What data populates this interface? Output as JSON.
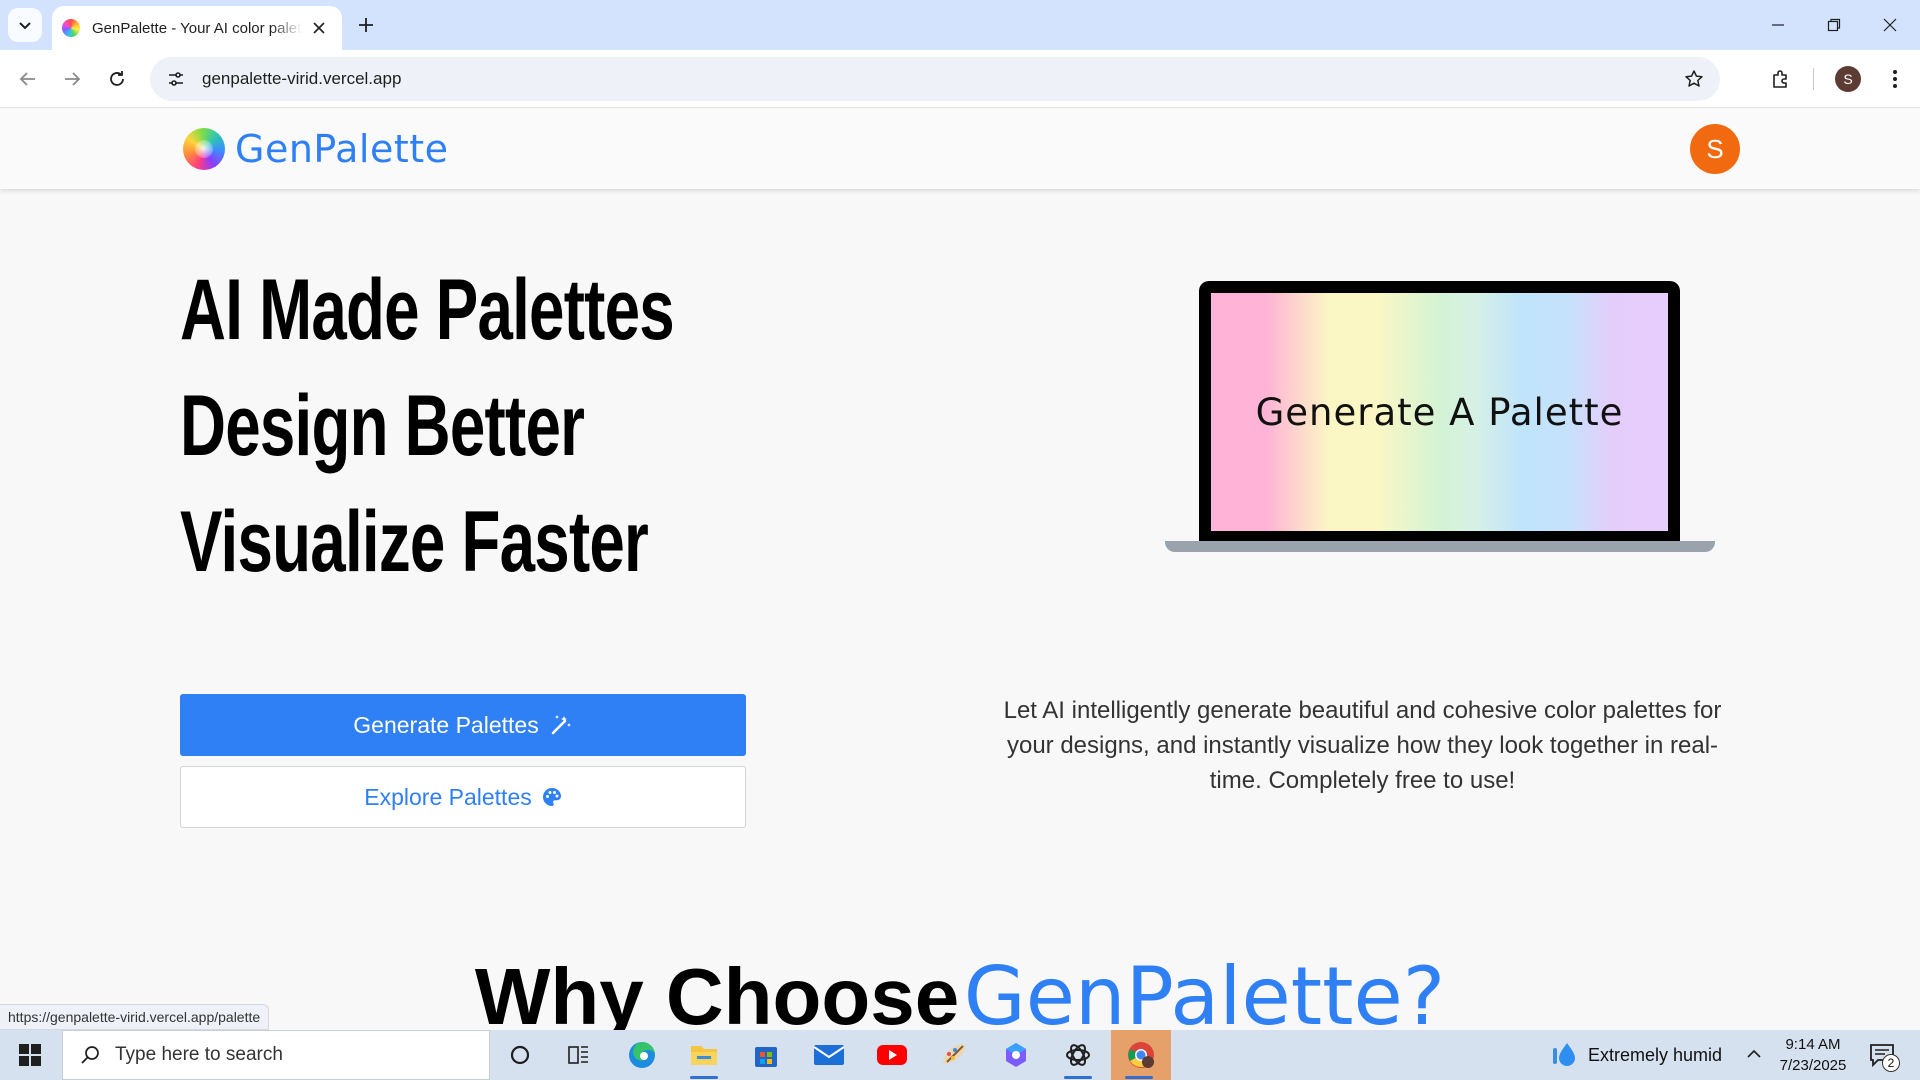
{
  "browser": {
    "tab_title": "GenPalette - Your AI color palette generator",
    "url": "genpalette-virid.vercel.app",
    "profile_initial": "S"
  },
  "header": {
    "brand": "GenPalette",
    "user_initial": "S"
  },
  "hero": {
    "line1": "AI Made Palettes",
    "line2": "Design Better",
    "line3": "Visualize Faster",
    "laptop_text": "Generate A Palette",
    "generate_button": "Generate Palettes",
    "explore_button": "Explore Palettes",
    "description": "Let AI intelligently generate beautiful and cohesive color palettes for your designs, and instantly visualize how they look together in real-time. Completely free to use!"
  },
  "why": {
    "prefix": "Why Choose",
    "brand": "GenPalette?"
  },
  "status_bar": {
    "link_url": "https://genpalette-virid.vercel.app/palette"
  },
  "taskbar": {
    "search_placeholder": "Type here to search",
    "weather_text": "Extremely humid",
    "time": "9:14 AM",
    "date": "7/23/2025",
    "notification_count": "2",
    "pinned_apps": [
      "cortana-icon",
      "task-view-icon",
      "edge-icon",
      "file-explorer-icon",
      "store-icon",
      "mail-icon",
      "youtube-icon",
      "paint-icon",
      "copilot-icon",
      "chatgpt-icon",
      "chrome-icon"
    ]
  },
  "colors": {
    "accent": "#2f7ff5",
    "avatar": "#f26a10",
    "palette_gradient": [
      "#ffb3d6",
      "#fbf7c4",
      "#d4f3d4",
      "#bfe4fb",
      "#e5cdfb"
    ]
  }
}
